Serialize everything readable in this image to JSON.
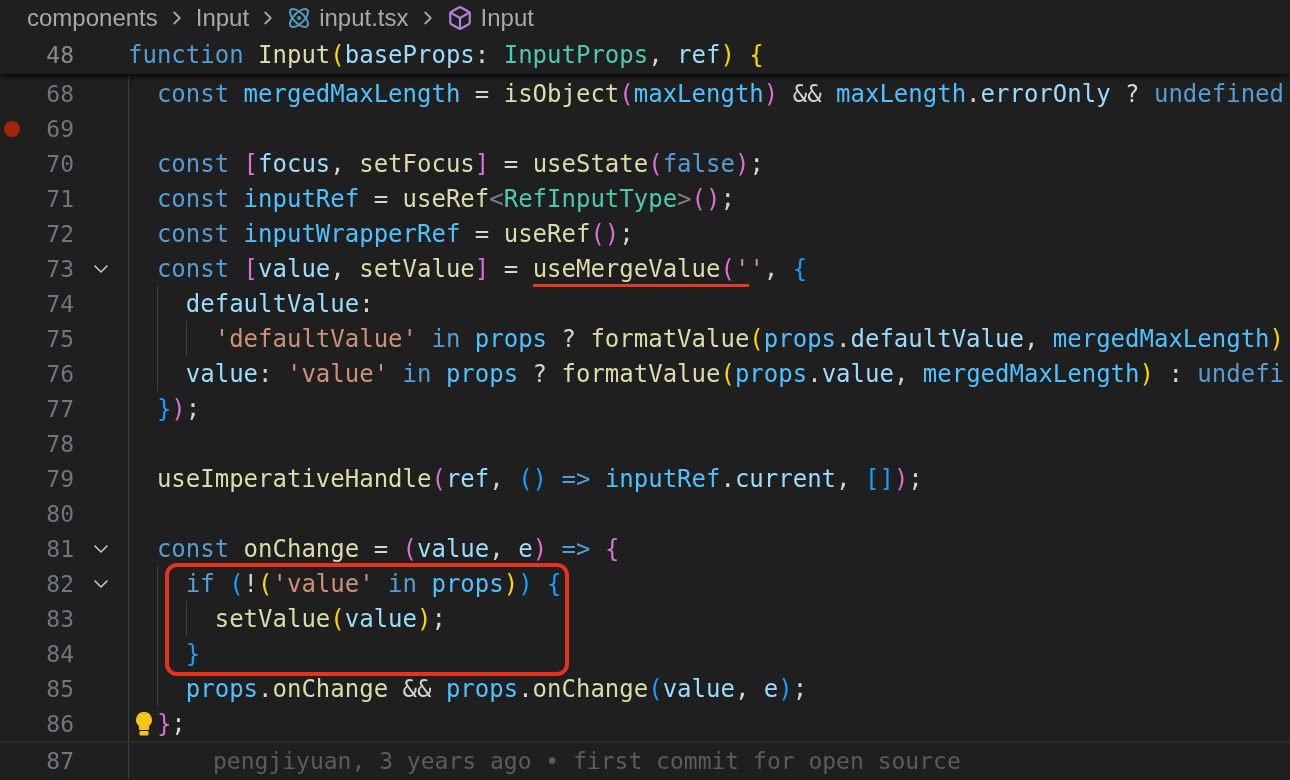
{
  "breadcrumbs": [
    {
      "label": "components",
      "kind": "folder"
    },
    {
      "label": "Input",
      "kind": "folder"
    },
    {
      "label": "input.tsx",
      "kind": "react-file"
    },
    {
      "label": "Input",
      "kind": "symbol"
    }
  ],
  "sticky_line": {
    "number": "48",
    "tokens": [
      {
        "text": "function ",
        "kind": "kw"
      },
      {
        "text": "Input",
        "kind": "fn"
      },
      {
        "text": "(",
        "kind": "b1"
      },
      {
        "text": "baseProps",
        "kind": "var"
      },
      {
        "text": ": ",
        "kind": "plain"
      },
      {
        "text": "InputProps",
        "kind": "type"
      },
      {
        "text": ", ",
        "kind": "plain"
      },
      {
        "text": "ref",
        "kind": "var"
      },
      {
        "text": ")",
        "kind": "b1"
      },
      {
        "text": " {",
        "kind": "b1"
      }
    ]
  },
  "lines": [
    {
      "number": "68",
      "fold": false,
      "breakpoint": false,
      "lightbulb": false,
      "boxed": false,
      "tokens": [
        {
          "text": "  const ",
          "kind": "kw"
        },
        {
          "text": "mergedMaxLength",
          "kind": "const"
        },
        {
          "text": " = ",
          "kind": "plain"
        },
        {
          "text": "isObject",
          "kind": "fn"
        },
        {
          "text": "(",
          "kind": "b2"
        },
        {
          "text": "maxLength",
          "kind": "const"
        },
        {
          "text": ")",
          "kind": "b2"
        },
        {
          "text": " && ",
          "kind": "plain"
        },
        {
          "text": "maxLength",
          "kind": "const"
        },
        {
          "text": ".",
          "kind": "plain"
        },
        {
          "text": "errorOnly",
          "kind": "var"
        },
        {
          "text": " ? ",
          "kind": "plain"
        },
        {
          "text": "undefined",
          "kind": "kw"
        }
      ]
    },
    {
      "number": "69",
      "fold": false,
      "breakpoint": true,
      "lightbulb": false,
      "boxed": false
    },
    {
      "number": "70",
      "fold": false,
      "breakpoint": false,
      "lightbulb": false,
      "boxed": false,
      "tokens": [
        {
          "text": "  const ",
          "kind": "kw"
        },
        {
          "text": "[",
          "kind": "b2"
        },
        {
          "text": "focus",
          "kind": "var"
        },
        {
          "text": ", ",
          "kind": "plain"
        },
        {
          "text": "setFocus",
          "kind": "fn"
        },
        {
          "text": "]",
          "kind": "b2"
        },
        {
          "text": " = ",
          "kind": "plain"
        },
        {
          "text": "useState",
          "kind": "fn"
        },
        {
          "text": "(",
          "kind": "b2"
        },
        {
          "text": "false",
          "kind": "kw"
        },
        {
          "text": ")",
          "kind": "b2"
        },
        {
          "text": ";",
          "kind": "plain"
        }
      ]
    },
    {
      "number": "71",
      "fold": false,
      "breakpoint": false,
      "lightbulb": false,
      "boxed": false,
      "tokens": [
        {
          "text": "  const ",
          "kind": "kw"
        },
        {
          "text": "inputRef",
          "kind": "const"
        },
        {
          "text": " = ",
          "kind": "plain"
        },
        {
          "text": "useRef",
          "kind": "fn"
        },
        {
          "text": "<",
          "kind": "angle"
        },
        {
          "text": "RefInputType",
          "kind": "type"
        },
        {
          "text": ">",
          "kind": "angle"
        },
        {
          "text": "()",
          "kind": "b2"
        },
        {
          "text": ";",
          "kind": "plain"
        }
      ]
    },
    {
      "number": "72",
      "fold": false,
      "breakpoint": false,
      "lightbulb": false,
      "boxed": false,
      "tokens": [
        {
          "text": "  const ",
          "kind": "kw"
        },
        {
          "text": "inputWrapperRef",
          "kind": "const"
        },
        {
          "text": " = ",
          "kind": "plain"
        },
        {
          "text": "useRef",
          "kind": "fn"
        },
        {
          "text": "()",
          "kind": "b2"
        },
        {
          "text": ";",
          "kind": "plain"
        }
      ]
    },
    {
      "number": "73",
      "fold": true,
      "breakpoint": false,
      "lightbulb": false,
      "boxed": false,
      "tokens": [
        {
          "text": "  const ",
          "kind": "kw"
        },
        {
          "text": "[",
          "kind": "b2"
        },
        {
          "text": "value",
          "kind": "var"
        },
        {
          "text": ", ",
          "kind": "plain"
        },
        {
          "text": "setValue",
          "kind": "fn"
        },
        {
          "text": "]",
          "kind": "b2"
        },
        {
          "text": " = ",
          "kind": "plain"
        },
        {
          "text": "useMergeValue",
          "kind": "fn",
          "underlined": true
        },
        {
          "text": "(",
          "kind": "b2",
          "underlined": true
        },
        {
          "text": "'",
          "kind": "str",
          "underlined": true
        },
        {
          "text": "'",
          "kind": "str",
          "underlined": false
        },
        {
          "text": ", ",
          "kind": "plain"
        },
        {
          "text": "{",
          "kind": "b3"
        }
      ]
    },
    {
      "number": "74",
      "fold": false,
      "breakpoint": false,
      "lightbulb": false,
      "boxed": false,
      "tokens": [
        {
          "text": "    defaultValue",
          "kind": "var"
        },
        {
          "text": ":",
          "kind": "plain"
        }
      ]
    },
    {
      "number": "75",
      "fold": false,
      "breakpoint": false,
      "lightbulb": false,
      "boxed": false,
      "tokens": [
        {
          "text": "      'defaultValue'",
          "kind": "str"
        },
        {
          "text": " in ",
          "kind": "kw"
        },
        {
          "text": "props",
          "kind": "const"
        },
        {
          "text": " ? ",
          "kind": "plain"
        },
        {
          "text": "formatValue",
          "kind": "fn"
        },
        {
          "text": "(",
          "kind": "b1"
        },
        {
          "text": "props",
          "kind": "const"
        },
        {
          "text": ".",
          "kind": "plain"
        },
        {
          "text": "defaultValue",
          "kind": "var"
        },
        {
          "text": ", ",
          "kind": "plain"
        },
        {
          "text": "mergedMaxLength",
          "kind": "const"
        },
        {
          "text": ")",
          "kind": "b1"
        }
      ]
    },
    {
      "number": "76",
      "fold": false,
      "breakpoint": false,
      "lightbulb": false,
      "boxed": false,
      "tokens": [
        {
          "text": "    value",
          "kind": "var"
        },
        {
          "text": ": ",
          "kind": "plain"
        },
        {
          "text": "'value'",
          "kind": "str"
        },
        {
          "text": " in ",
          "kind": "kw"
        },
        {
          "text": "props",
          "kind": "const"
        },
        {
          "text": " ? ",
          "kind": "plain"
        },
        {
          "text": "formatValue",
          "kind": "fn"
        },
        {
          "text": "(",
          "kind": "b1"
        },
        {
          "text": "props",
          "kind": "const"
        },
        {
          "text": ".",
          "kind": "plain"
        },
        {
          "text": "value",
          "kind": "var"
        },
        {
          "text": ", ",
          "kind": "plain"
        },
        {
          "text": "mergedMaxLength",
          "kind": "const"
        },
        {
          "text": ")",
          "kind": "b1"
        },
        {
          "text": " : ",
          "kind": "plain"
        },
        {
          "text": "undefi",
          "kind": "kw"
        }
      ]
    },
    {
      "number": "77",
      "fold": false,
      "breakpoint": false,
      "lightbulb": false,
      "boxed": false,
      "tokens": [
        {
          "text": "  }",
          "kind": "b3"
        },
        {
          "text": ")",
          "kind": "b2"
        },
        {
          "text": ";",
          "kind": "plain"
        }
      ]
    },
    {
      "number": "78",
      "fold": false,
      "breakpoint": false,
      "lightbulb": false,
      "boxed": false
    },
    {
      "number": "79",
      "fold": false,
      "breakpoint": false,
      "lightbulb": false,
      "boxed": false,
      "tokens": [
        {
          "text": "  useImperativeHandle",
          "kind": "fn"
        },
        {
          "text": "(",
          "kind": "b2"
        },
        {
          "text": "ref",
          "kind": "var"
        },
        {
          "text": ", ",
          "kind": "plain"
        },
        {
          "text": "()",
          "kind": "b3"
        },
        {
          "text": " => ",
          "kind": "kw"
        },
        {
          "text": "inputRef",
          "kind": "const"
        },
        {
          "text": ".",
          "kind": "plain"
        },
        {
          "text": "current",
          "kind": "var"
        },
        {
          "text": ", ",
          "kind": "plain"
        },
        {
          "text": "[]",
          "kind": "b3"
        },
        {
          "text": ")",
          "kind": "b2"
        },
        {
          "text": ";",
          "kind": "plain"
        }
      ]
    },
    {
      "number": "80",
      "fold": false,
      "breakpoint": false,
      "lightbulb": false,
      "boxed": false
    },
    {
      "number": "81",
      "fold": true,
      "breakpoint": false,
      "lightbulb": false,
      "boxed": false,
      "tokens": [
        {
          "text": "  const ",
          "kind": "kw"
        },
        {
          "text": "onChange",
          "kind": "fn"
        },
        {
          "text": " = ",
          "kind": "plain"
        },
        {
          "text": "(",
          "kind": "b2"
        },
        {
          "text": "value",
          "kind": "var"
        },
        {
          "text": ", ",
          "kind": "plain"
        },
        {
          "text": "e",
          "kind": "var"
        },
        {
          "text": ")",
          "kind": "b2"
        },
        {
          "text": " => ",
          "kind": "kw"
        },
        {
          "text": "{",
          "kind": "b2"
        }
      ]
    },
    {
      "number": "82",
      "fold": true,
      "breakpoint": false,
      "lightbulb": false,
      "boxed": true,
      "tokens": [
        {
          "text": "    if ",
          "kind": "kw"
        },
        {
          "text": "(",
          "kind": "b3"
        },
        {
          "text": "!",
          "kind": "plain"
        },
        {
          "text": "(",
          "kind": "b1"
        },
        {
          "text": "'value'",
          "kind": "str"
        },
        {
          "text": " in ",
          "kind": "kw"
        },
        {
          "text": "props",
          "kind": "const"
        },
        {
          "text": ")",
          "kind": "b1"
        },
        {
          "text": ")",
          "kind": "b3"
        },
        {
          "text": " {",
          "kind": "b3"
        }
      ]
    },
    {
      "number": "83",
      "fold": false,
      "breakpoint": false,
      "lightbulb": false,
      "boxed": true,
      "tokens": [
        {
          "text": "      setValue",
          "kind": "fn"
        },
        {
          "text": "(",
          "kind": "b1"
        },
        {
          "text": "value",
          "kind": "var"
        },
        {
          "text": ")",
          "kind": "b1"
        },
        {
          "text": ";",
          "kind": "plain"
        }
      ]
    },
    {
      "number": "84",
      "fold": false,
      "breakpoint": false,
      "lightbulb": false,
      "boxed": true,
      "tokens": [
        {
          "text": "    }",
          "kind": "b3"
        }
      ]
    },
    {
      "number": "85",
      "fold": false,
      "breakpoint": false,
      "lightbulb": false,
      "boxed": false,
      "tokens": [
        {
          "text": "    props",
          "kind": "const"
        },
        {
          "text": ".",
          "kind": "plain"
        },
        {
          "text": "onChange",
          "kind": "fn"
        },
        {
          "text": " && ",
          "kind": "plain"
        },
        {
          "text": "props",
          "kind": "const"
        },
        {
          "text": ".",
          "kind": "plain"
        },
        {
          "text": "onChange",
          "kind": "fn"
        },
        {
          "text": "(",
          "kind": "b3"
        },
        {
          "text": "value",
          "kind": "var"
        },
        {
          "text": ", ",
          "kind": "plain"
        },
        {
          "text": "e",
          "kind": "var"
        },
        {
          "text": ")",
          "kind": "b3"
        },
        {
          "text": ";",
          "kind": "plain"
        }
      ]
    },
    {
      "number": "86",
      "fold": false,
      "breakpoint": false,
      "lightbulb": true,
      "boxed": false,
      "tokens": [
        {
          "text": "  }",
          "kind": "b2"
        },
        {
          "text": ";",
          "kind": "plain"
        }
      ]
    },
    {
      "number": "87",
      "fold": false,
      "breakpoint": false,
      "lightbulb": false,
      "boxed": false,
      "blame": "pengjiyuan, 3 years ago • first commit for open source"
    }
  ]
}
